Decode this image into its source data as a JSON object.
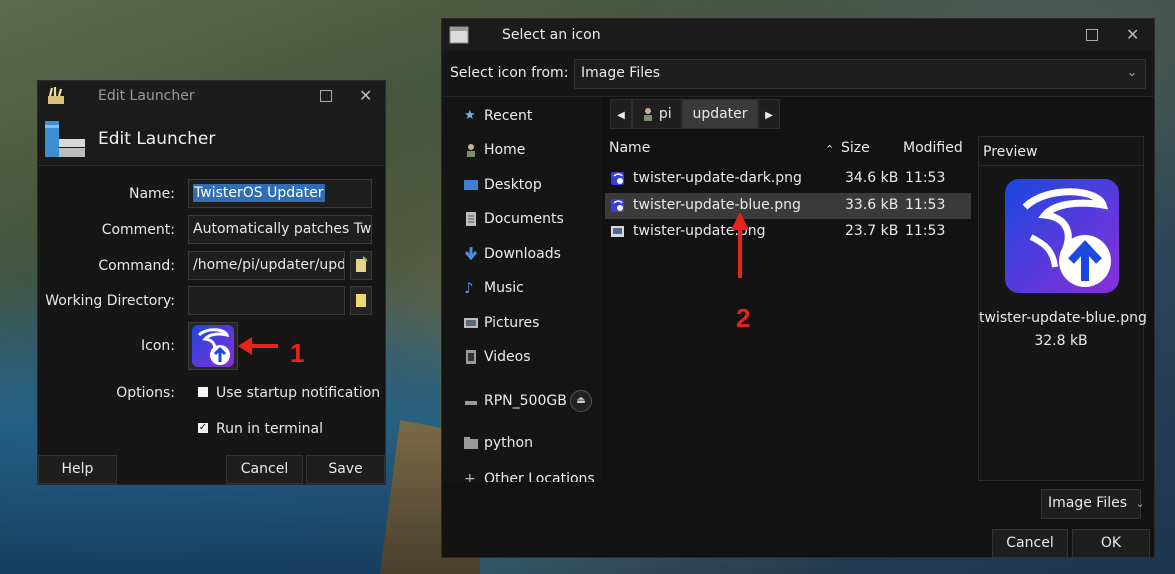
{
  "launcher": {
    "window_title": "Edit Launcher",
    "header_title": "Edit Launcher",
    "name_label": "Name:",
    "name_value": "TwisterOS Updater",
    "comment_label": "Comment:",
    "comment_value": "Automatically patches Twis",
    "command_label": "Command:",
    "command_value": "/home/pi/updater/upd",
    "workdir_label": "Working Directory:",
    "workdir_value": "",
    "icon_label": "Icon:",
    "options_label": "Options:",
    "opt_startup": "Use startup notification",
    "opt_startup_checked": false,
    "opt_terminal": "Run in terminal",
    "opt_terminal_checked": true,
    "help_btn": "Help",
    "cancel_btn": "Cancel",
    "save_btn": "Save"
  },
  "annotations": {
    "one": "1",
    "two": "2"
  },
  "dialog": {
    "title": "Select an icon",
    "select_from_label": "Select icon from:",
    "select_from_value": "Image Files",
    "places": [
      {
        "label": "Recent",
        "icon": "star-icon"
      },
      {
        "label": "Home",
        "icon": "home-icon"
      },
      {
        "label": "Desktop",
        "icon": "desktop-icon"
      },
      {
        "label": "Documents",
        "icon": "document-icon"
      },
      {
        "label": "Downloads",
        "icon": "download-icon"
      },
      {
        "label": "Music",
        "icon": "music-icon"
      },
      {
        "label": "Pictures",
        "icon": "pictures-icon"
      },
      {
        "label": "Videos",
        "icon": "video-icon"
      },
      {
        "label": "RPN_500GB",
        "icon": "drive-icon"
      },
      {
        "label": "python",
        "icon": "folder-icon"
      },
      {
        "label": "Other Locations",
        "icon": "plus-icon"
      }
    ],
    "path": {
      "home_crumb": "pi",
      "current_crumb": "updater"
    },
    "columns": {
      "name": "Name",
      "size": "Size",
      "modified": "Modified"
    },
    "files": [
      {
        "name": "twister-update-dark.png",
        "size": "34.6 kB",
        "modified": "11:53"
      },
      {
        "name": "twister-update-blue.png",
        "size": "33.6 kB",
        "modified": "11:53"
      },
      {
        "name": "twister-update.png",
        "size": "23.7 kB",
        "modified": "11:53"
      }
    ],
    "selected_index": 1,
    "preview": {
      "header": "Preview",
      "name": "twister-update-blue.png",
      "size": "32.8 kB"
    },
    "filter_value": "Image Files",
    "cancel_btn": "Cancel",
    "ok_btn": "OK"
  },
  "colors": {
    "selection": "#2f6eb5",
    "annotation": "#e8231c",
    "icon_blue": "#1a48e0",
    "icon_purple": "#8b2fd8"
  }
}
